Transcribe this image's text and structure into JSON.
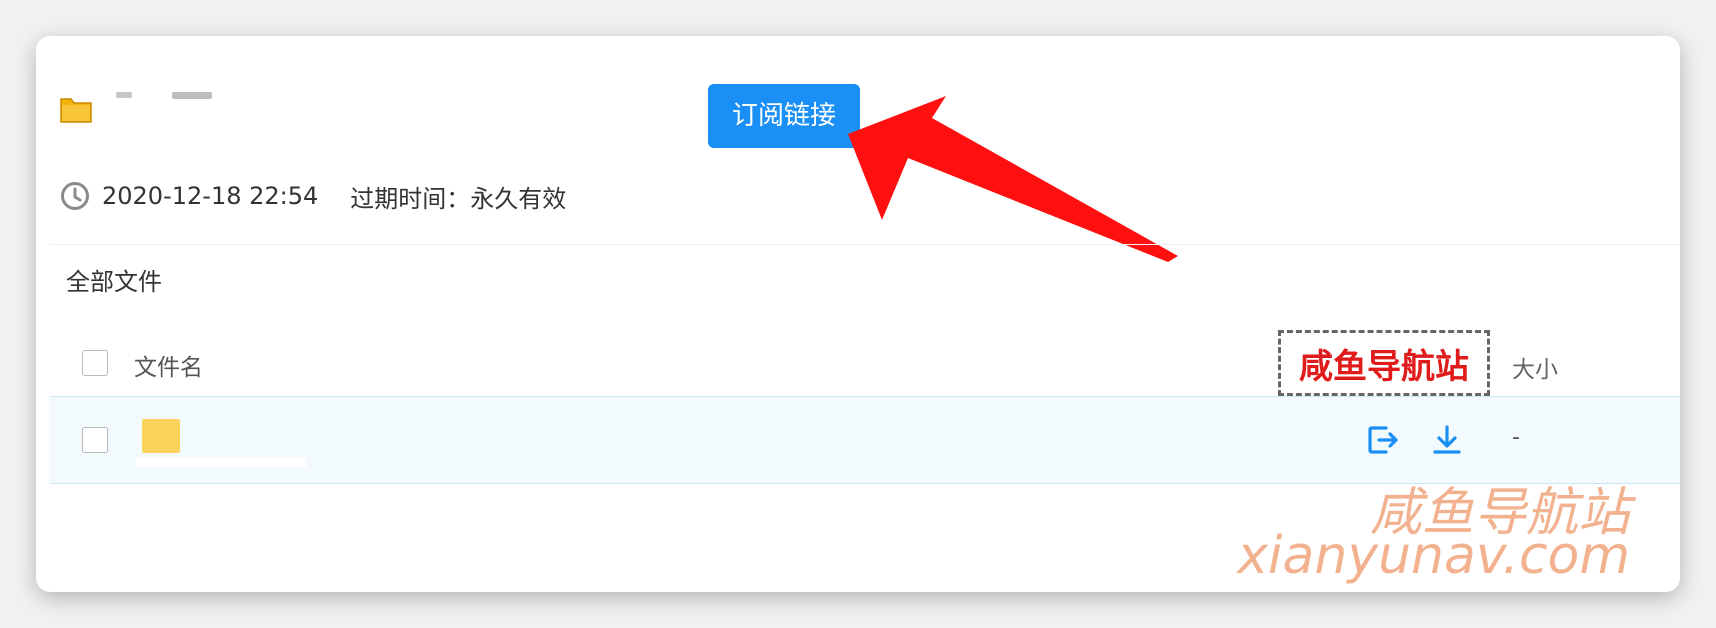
{
  "header": {
    "subscribe_button": "订阅链接"
  },
  "meta": {
    "created_time": "2020-12-18 22:54",
    "expiry": "过期时间：永久有效"
  },
  "breadcrumb": {
    "label": "全部文件"
  },
  "table": {
    "columns": {
      "name": "文件名",
      "size": "大小"
    },
    "rows": [
      {
        "size": "-"
      }
    ]
  },
  "watermarks": {
    "boxed_label": "咸鱼导航站",
    "corner_label_cn": "咸鱼导航站",
    "corner_label_en": "xianyunav.com"
  },
  "colors": {
    "primary": "#1a8ff6",
    "arrow": "#ff1010",
    "folder": "#fbd35a",
    "watermark_red": "#e01b1b",
    "watermark_orange": "#ec9260"
  },
  "icons": {
    "folder": "folder-icon",
    "clock": "clock-icon",
    "save": "save-to-drive-icon",
    "download": "download-icon"
  }
}
